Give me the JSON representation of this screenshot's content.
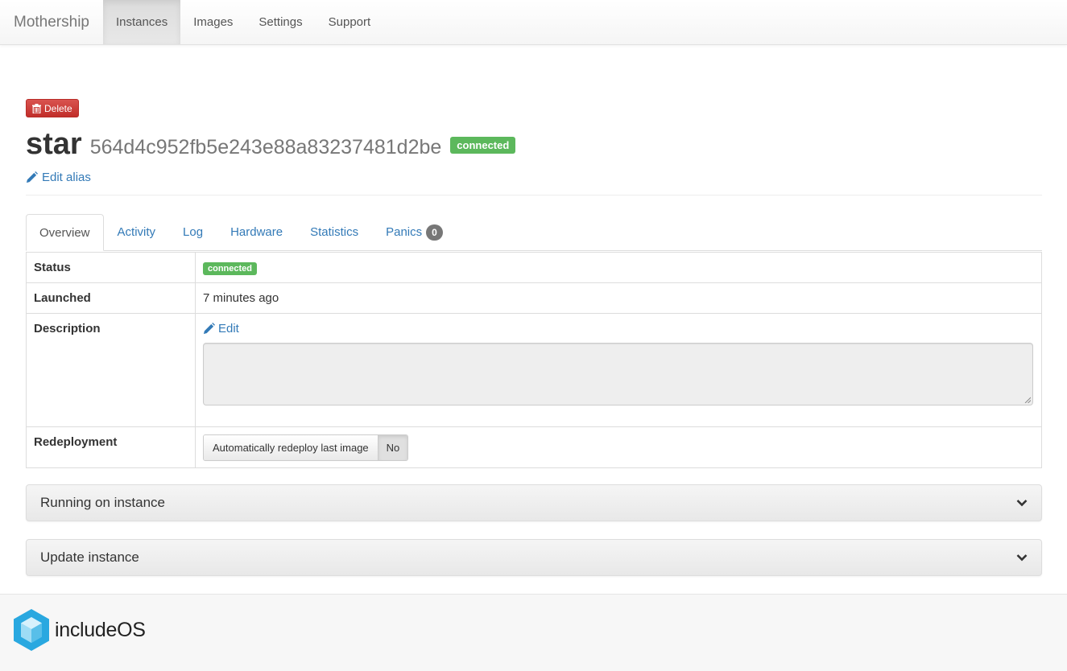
{
  "navbar": {
    "brand": "Mothership",
    "items": [
      {
        "label": "Instances",
        "active": true
      },
      {
        "label": "Images",
        "active": false
      },
      {
        "label": "Settings",
        "active": false
      },
      {
        "label": "Support",
        "active": false
      }
    ]
  },
  "instance": {
    "delete_label": "Delete",
    "alias": "star",
    "id": "564d4c952fb5e243e88a83237481d2be",
    "status_badge": "connected",
    "edit_alias_label": "Edit alias"
  },
  "tabs": [
    {
      "label": "Overview",
      "active": true
    },
    {
      "label": "Activity"
    },
    {
      "label": "Log"
    },
    {
      "label": "Hardware"
    },
    {
      "label": "Statistics"
    },
    {
      "label": "Panics",
      "count": "0"
    }
  ],
  "overview": {
    "status_label": "Status",
    "status_value": "connected",
    "launched_label": "Launched",
    "launched_value": "7 minutes ago",
    "description_label": "Description",
    "description_edit_label": "Edit",
    "description_value": "",
    "redeployment_label": "Redeployment",
    "redeploy_button_label": "Automatically redeploy last image",
    "redeploy_value": "No"
  },
  "panels": {
    "running": "Running on instance",
    "update": "Update instance"
  },
  "footer": {
    "logo_text": "includeOS"
  },
  "colors": {
    "success": "#5cb85c",
    "danger": "#d9534f",
    "link": "#337ab7",
    "logo_blue": "#29a8e0"
  }
}
